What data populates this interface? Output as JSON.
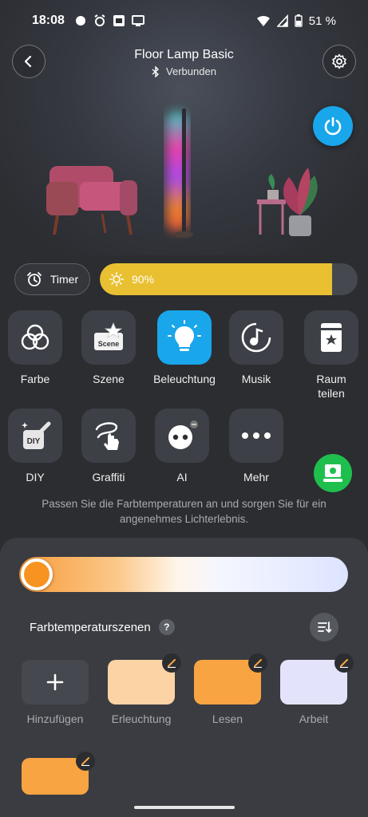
{
  "status": {
    "time": "18:08",
    "battery": "51 %"
  },
  "header": {
    "title": "Floor Lamp Basic",
    "connection": "Verbunden"
  },
  "controls": {
    "timer_label": "Timer",
    "brightness": 90,
    "brightness_label": "90%"
  },
  "modes": [
    {
      "label": "Farbe",
      "icon": "color-circles-icon"
    },
    {
      "label": "Szene",
      "icon": "scene-icon",
      "icon_text": "Scene"
    },
    {
      "label": "Beleuchtung",
      "icon": "bulb-icon",
      "active": true
    },
    {
      "label": "Musik",
      "icon": "music-note-icon"
    },
    {
      "label": "Raum teilen",
      "icon": "room-share-icon"
    },
    {
      "label": "DIY",
      "icon": "diy-icon",
      "icon_text": "DIY"
    },
    {
      "label": "Graffiti",
      "icon": "graffiti-hand-icon"
    },
    {
      "label": "AI",
      "icon": "ai-robot-icon"
    },
    {
      "label": "Mehr",
      "icon": "more-dots-icon"
    }
  ],
  "hint": "Passen Sie die Farbtemperaturen an und sorgen Sie für ein angenehmes Lichterlebnis.",
  "color_temp": {
    "value_fraction": 0.0,
    "gradient_colors": [
      "#f89b3a",
      "#fbc98a",
      "#fff5ea",
      "#f4f6ff",
      "#dde4ff"
    ]
  },
  "scenes": {
    "heading": "Farbtemperaturszenen",
    "help": "?",
    "items": [
      {
        "label": "Hinzufügen",
        "color": "#45484e",
        "add": true
      },
      {
        "label": "Erleuchtung",
        "color": "#fcd3a4"
      },
      {
        "label": "Lesen",
        "color": "#f8a443"
      },
      {
        "label": "Arbeit",
        "color": "#e3e4fb"
      },
      {
        "label": "",
        "color": "#f8a443"
      }
    ]
  },
  "colors": {
    "accent_blue": "#19a6ea",
    "brightness_yellow": "#e9c032",
    "green_fab": "#1fbf4e"
  }
}
